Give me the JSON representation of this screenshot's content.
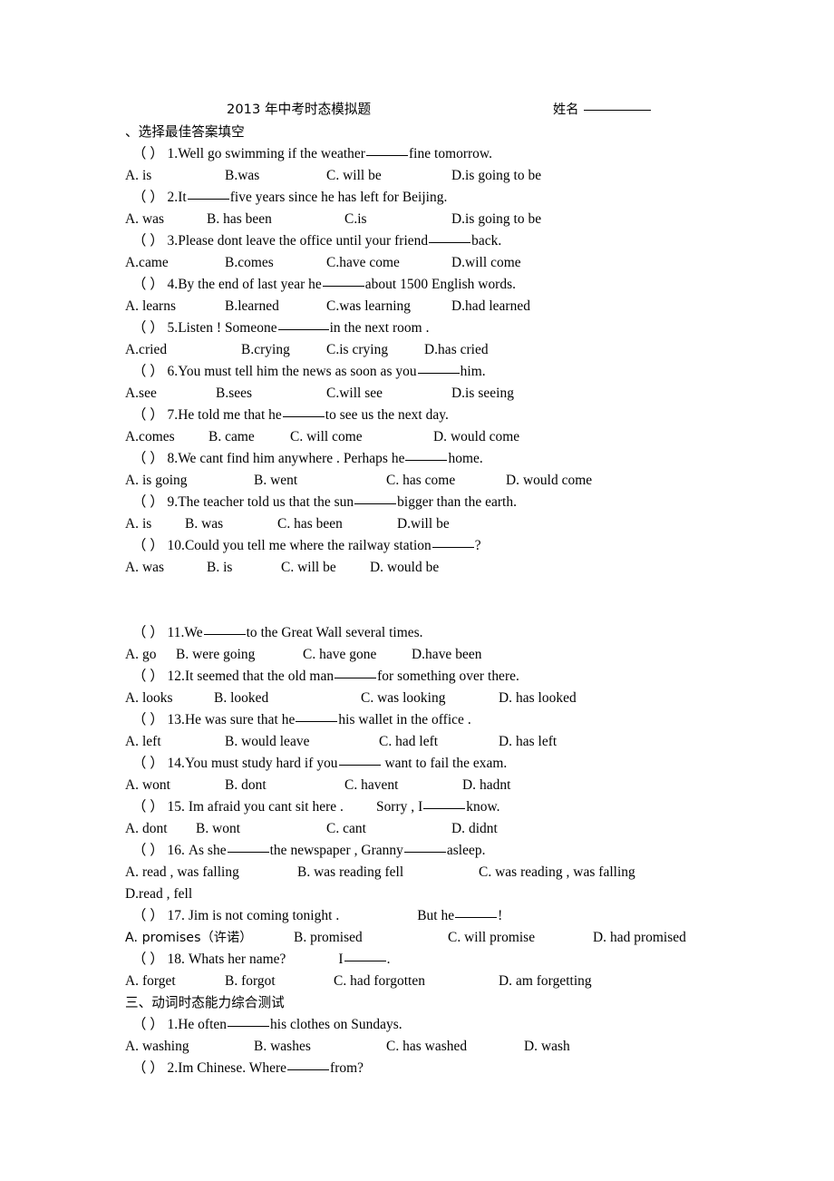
{
  "document": {
    "title": "2013 年中考时态模拟题",
    "name_label": "姓名",
    "name_value": ""
  },
  "sections": [
    {
      "heading": "、选择最佳答案填空",
      "questions": [
        {
          "marker": "（     ）",
          "number": "1.",
          "text_before": "Well go swimming if the weather",
          "gap": "blank",
          "text_after": "fine tomorrow.",
          "options": [
            "A. is",
            "B.was",
            "C. will be",
            "D.is going to be"
          ],
          "option_offsets": [
            0,
            110,
            222,
            360
          ]
        },
        {
          "marker": "（     ）",
          "number": "2.",
          "text_before": "It",
          "gap": "blank",
          "text_after": "five years since he has left for Beijing.",
          "options": [
            "A. was",
            "B. has been",
            "C.is",
            "D.is going to be"
          ],
          "option_offsets": [
            0,
            90,
            242,
            360
          ]
        },
        {
          "marker": "（     ）",
          "number": "3.",
          "text_before": "Please dont leave the office until your friend",
          "gap": "blank",
          "text_after": "back.",
          "options": [
            "A.came",
            "B.comes",
            "C.have come",
            "D.will come"
          ],
          "option_offsets": [
            0,
            110,
            222,
            360
          ]
        },
        {
          "marker": "（     ）",
          "number": "4.",
          "text_before": "By the end of last year he",
          "gap": "blank",
          "text_after": "about 1500 English words.",
          "options": [
            "A. learns",
            "B.learned",
            "C.was learning",
            "D.had learned"
          ],
          "option_offsets": [
            0,
            110,
            222,
            360
          ]
        },
        {
          "marker": "（     ）",
          "number": "5.",
          "text_before": "Listen ! Someone",
          "gap": "blank",
          "text_after": "in the next room .",
          "options": [
            "A.cried",
            "B.crying",
            "C.is crying",
            "D.has cried"
          ],
          "option_offsets": [
            0,
            128,
            222,
            330
          ]
        },
        {
          "marker": "（     ）",
          "number": "6.",
          "text_before": "You must tell him the news as soon as you",
          "gap": "blank",
          "text_after": "him.",
          "options": [
            "A.see",
            "B.sees",
            "C.will see",
            "D.is seeing"
          ],
          "option_offsets": [
            0,
            100,
            222,
            360
          ]
        },
        {
          "marker": "（     ）",
          "number": "7.",
          "text_before": "He told me that he",
          "gap": "blank",
          "text_after": "to see us the next day.",
          "options": [
            "A.comes",
            "B. came",
            "C. will come",
            "D. would come"
          ],
          "option_offsets": [
            0,
            92,
            182,
            340
          ]
        },
        {
          "marker": "（     ）",
          "number": "8.",
          "text_before": "We cant find him anywhere . Perhaps he",
          "gap": "blank",
          "text_after": "home.",
          "options": [
            "A. is going",
            "B. went",
            "C. has come",
            "D. would come"
          ],
          "option_offsets": [
            0,
            142,
            288,
            420
          ]
        },
        {
          "marker": "（     ）",
          "number": "9.",
          "text_before": "The teacher told us that the sun",
          "gap": "blank",
          "text_after": "bigger than the earth.",
          "options": [
            "A. is",
            "B. was",
            "C. has been",
            "D.will be"
          ],
          "option_offsets": [
            0,
            66,
            168,
            300
          ]
        },
        {
          "marker": "（     ）",
          "number": "10.",
          "text_before": "Could you tell me where the railway station",
          "gap": "blank",
          "text_after": "?",
          "options": [
            "A. was",
            "B. is",
            "C. will be",
            "D. would be"
          ],
          "option_offsets": [
            0,
            90,
            172,
            270
          ]
        },
        {
          "marker": "（     ）",
          "number": "11.",
          "text_before": "We",
          "gap": "blank",
          "text_after": "to the Great Wall several times.",
          "options": [
            "A. go",
            "B. were going",
            "C. have gone",
            "D.have been"
          ],
          "option_offsets": [
            0,
            56,
            196,
            316
          ]
        },
        {
          "marker": "（     ）",
          "number": "12.",
          "text_before": "It seemed that the old man",
          "gap": "blank",
          "text_after": "for something over there.",
          "options": [
            "A. looks",
            "B. looked",
            "C. was looking",
            "D. has looked"
          ],
          "option_offsets": [
            0,
            98,
            260,
            412
          ]
        },
        {
          "marker": "（     ）",
          "number": "13.",
          "text_before": "He was sure that he",
          "gap": "blank",
          "text_after": "his wallet in the office .",
          "options": [
            "A. left",
            "B. would leave",
            "C. had left",
            "D. has left"
          ],
          "option_offsets": [
            0,
            110,
            280,
            412
          ]
        },
        {
          "marker": "（     ）",
          "number": "14.",
          "text_before": "You must study hard if you",
          "gap": "blank",
          "text_after": " want to fail the exam.",
          "options": [
            "A. wont",
            "B. dont",
            "C. havent",
            "D. hadnt"
          ],
          "option_offsets": [
            0,
            110,
            242,
            372
          ]
        },
        {
          "marker": "（     ）",
          "number": "15.",
          "text_before": " Im afraid you cant sit here .",
          "gap": "blank",
          "text_after": "know.",
          "text_mid": "Sorry , I",
          "options": [
            "A. dont",
            "B. wont",
            "C. cant",
            "D. didnt"
          ],
          "option_offsets": [
            0,
            78,
            222,
            360
          ]
        },
        {
          "marker": "（     ）",
          "number": "16.",
          "text_before": " As she",
          "gap": "blank",
          "text_mid": "the newspaper , Granny",
          "text_after": "asleep.",
          "options": [
            "A. read , was falling",
            "B. was reading fell",
            "C. was reading , was falling"
          ],
          "option_offsets": [
            0,
            190,
            390
          ],
          "options_wrap": [
            "D.read , fell"
          ]
        },
        {
          "marker": "（     ）",
          "number": "17.",
          "text_before": " Jim is not coming tonight .",
          "text_mid": "But he",
          "gap": "blank",
          "text_after": "!",
          "options": [
            "A. promises（许诺）",
            "B. promised",
            "C. will promise",
            "D. had promised"
          ],
          "option_offsets": [
            0,
            186,
            356,
            516
          ]
        },
        {
          "marker": "（     ）",
          "number": "18.",
          "text_before": " Whats her name?",
          "text_mid": "I",
          "gap": "blank",
          "text_after": ".",
          "options": [
            "A. forget",
            "B. forgot",
            "C. had forgotten",
            "D. am forgetting"
          ],
          "option_offsets": [
            0,
            110,
            230,
            412
          ]
        }
      ]
    },
    {
      "heading": "三、动词时态能力综合测试",
      "questions": [
        {
          "marker": "（     ）",
          "number": "1.",
          "text_before": "He often",
          "gap": "blank",
          "text_after": "his clothes on Sundays.",
          "options": [
            "A. washing",
            "B. washes",
            "C. has washed",
            "D. wash"
          ],
          "option_offsets": [
            0,
            142,
            288,
            440
          ]
        },
        {
          "marker": "（     ）",
          "number": "2.",
          "text_before": "Im Chinese. Where",
          "gap": "blank",
          "text_after": "from?",
          "options": [],
          "option_offsets": []
        }
      ]
    }
  ]
}
